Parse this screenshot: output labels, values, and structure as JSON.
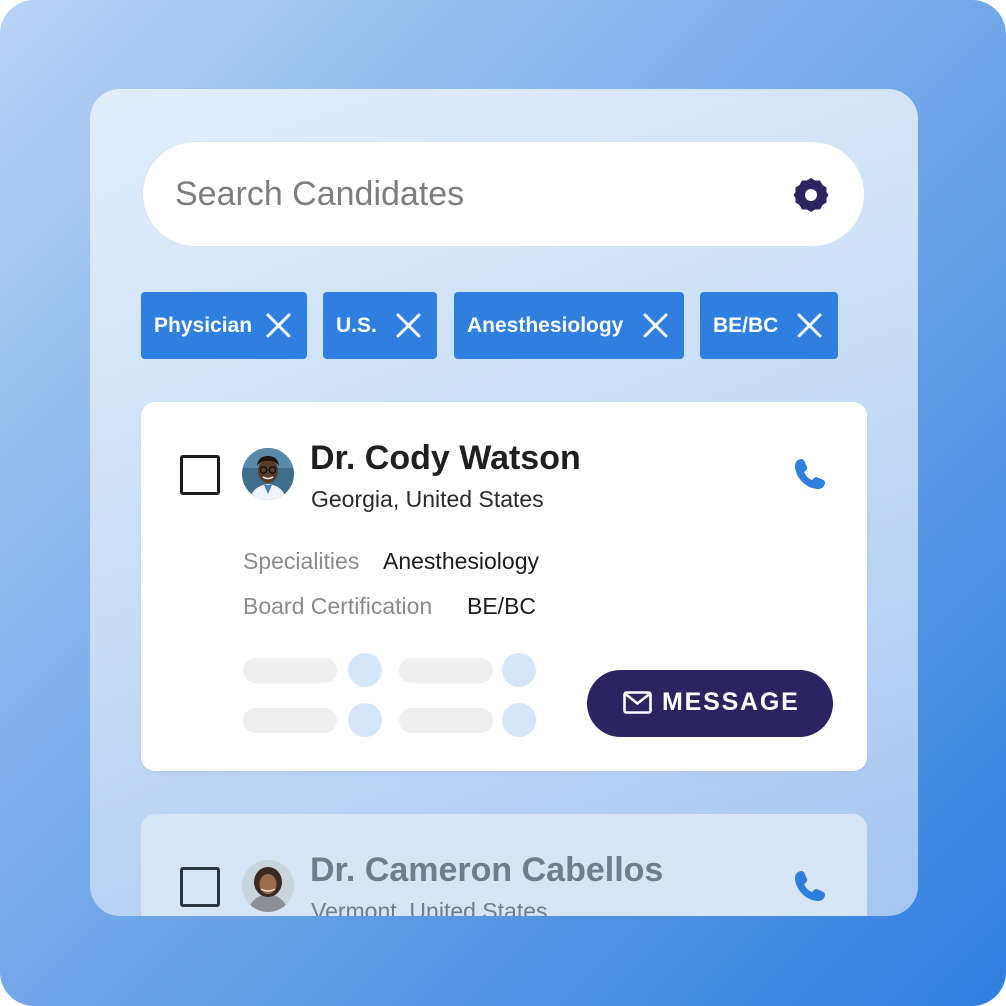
{
  "search": {
    "placeholder": "Search Candidates",
    "value": "",
    "settings_icon": "gear-icon",
    "icon_color": "#2b2460"
  },
  "filters": [
    {
      "label": "Physician"
    },
    {
      "label": "U.S."
    },
    {
      "label": "Anesthesiology"
    },
    {
      "label": "BE/BC"
    }
  ],
  "candidates": [
    {
      "name": "Dr. Cody Watson",
      "location": "Georgia, United States",
      "speciality_label": "Specialities",
      "speciality_value": "Anesthesiology",
      "board_label": "Board Certification",
      "board_value": "BE/BC",
      "message_label": "MESSAGE",
      "checked": false
    },
    {
      "name": "Dr. Cameron Cabellos",
      "location": "Vermont, United States",
      "checked": false
    }
  ],
  "colors": {
    "accent": "#2e7fdf",
    "button_dark": "#2b2460",
    "skeleton_dot": "#d6e6fa",
    "skeleton_bar": "#efefef"
  }
}
